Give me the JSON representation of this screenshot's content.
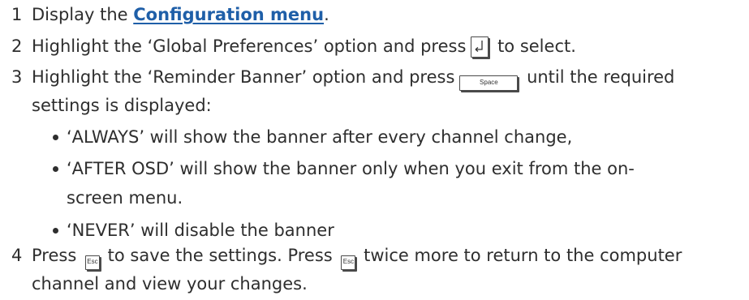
{
  "steps": [
    {
      "number": "1",
      "before": "Display the ",
      "link": "Configuration menu",
      "after": "."
    },
    {
      "number": "2",
      "before": "Highlight the ‘Global Preferences’ option and press",
      "key_icon": "enter-key-icon",
      "after": " to select."
    },
    {
      "number": "3",
      "line1_before": "Highlight the ‘Reminder Banner’ option and press",
      "key_label": "Space",
      "line1_after": " until the required",
      "line2": "settings is displayed:",
      "bullets": [
        {
          "line1": "‘ALWAYS’ will show the banner after every channel change,"
        },
        {
          "line1": "‘AFTER OSD’ will show the banner only when you exit from the on-",
          "line2": "screen menu."
        },
        {
          "line1": "‘NEVER’ will disable the banner"
        }
      ]
    },
    {
      "number": "4",
      "part1": "Press ",
      "key_label_1": "Esc",
      "part2": " to save the settings. Press ",
      "key_label_2": "Esc",
      "part3": " twice more to return to the computer",
      "line2": "channel and view your changes."
    }
  ]
}
